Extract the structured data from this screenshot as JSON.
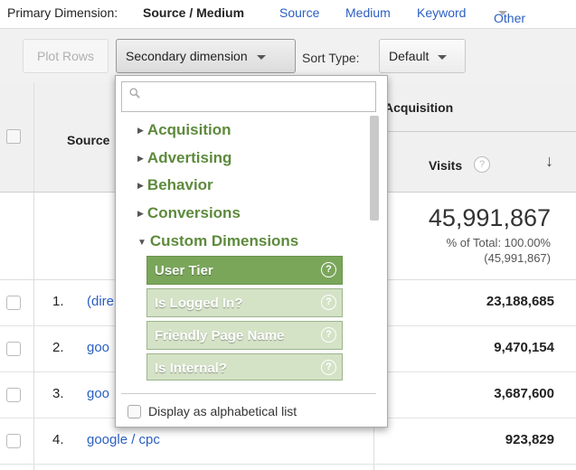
{
  "primary": {
    "label": "Primary Dimension:",
    "active": "Source / Medium",
    "links": [
      "Source",
      "Medium",
      "Keyword",
      "Other"
    ]
  },
  "toolbar": {
    "plot_rows": "Plot Rows",
    "secondary_dimension": "Secondary dimension",
    "sort_type_label": "Sort Type:",
    "sort_type_value": "Default"
  },
  "table": {
    "source_header": "Source",
    "acquisition_header": "Acquisition",
    "visits_header": "Visits",
    "help": "?",
    "sort_arrow": "↓",
    "total_visits": "45,991,867",
    "total_pct": "% of Total: 100.00%",
    "total_abs": "(45,991,867)",
    "rows": [
      {
        "num": "1.",
        "source": "(dire",
        "visits": "23,188,685"
      },
      {
        "num": "2.",
        "source": "goo",
        "visits": "9,470,154"
      },
      {
        "num": "3.",
        "source": "goo",
        "visits": "3,687,600"
      },
      {
        "num": "4.",
        "source": "google / cpc",
        "visits": "923,829"
      }
    ]
  },
  "dropdown": {
    "search_placeholder": "",
    "categories": [
      {
        "label": "Acquisition",
        "expanded": false
      },
      {
        "label": "Advertising",
        "expanded": false
      },
      {
        "label": "Behavior",
        "expanded": false
      },
      {
        "label": "Conversions",
        "expanded": false
      },
      {
        "label": "Custom Dimensions",
        "expanded": true
      }
    ],
    "items": [
      {
        "label": "User Tier",
        "active": true
      },
      {
        "label": "Is Logged In?",
        "active": false
      },
      {
        "label": "Friendly Page Name",
        "active": false
      },
      {
        "label": "Is Internal?",
        "active": false
      }
    ],
    "alphabetical_label": "Display as alphabetical list"
  },
  "colors": {
    "link": "#2b5fc1",
    "category_green": "#5d8a3c",
    "item_active": "#7aa65a",
    "item_inactive": "#d4e2c6"
  }
}
